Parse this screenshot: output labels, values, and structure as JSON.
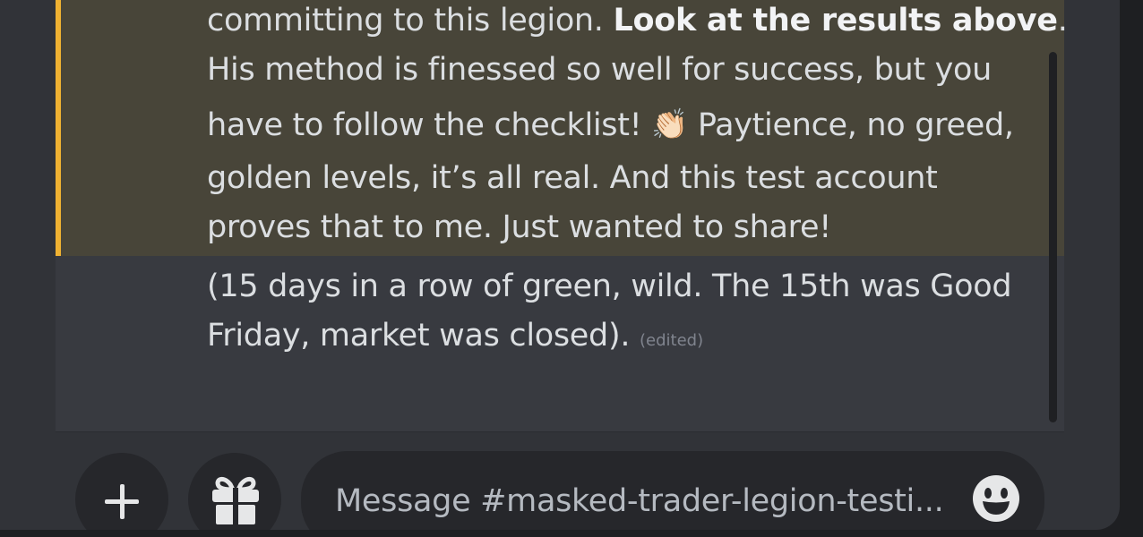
{
  "message": {
    "lines": [
      {
        "pre": "committing to this legion. ",
        "bold": "Look at the results above",
        "post": "."
      },
      {
        "text": "His method is finessed so well for success, but you"
      },
      {
        "pre": "have to follow the checklist! ",
        "emoji": "👏🏻",
        "post": " Paytience, no greed,"
      },
      {
        "text": "golden levels, it’s all real. And this test account"
      },
      {
        "text": "proves that to me. Just wanted to share!"
      },
      {
        "text": "(15 days in a row of green, wild. The 15th was Good"
      },
      {
        "text": "Friday, market was closed)."
      }
    ],
    "edited_label": "(edited)"
  },
  "composer": {
    "placeholder": "Message #masked-trader-legion-testi...",
    "plus_icon": "plus-icon",
    "gift_icon": "gift-icon",
    "emoji_icon": "emoji-icon"
  },
  "colors": {
    "mention_highlight_bar": "#f0b232",
    "mention_highlight_bg": "#484539",
    "chat_bg": "#383a40"
  }
}
